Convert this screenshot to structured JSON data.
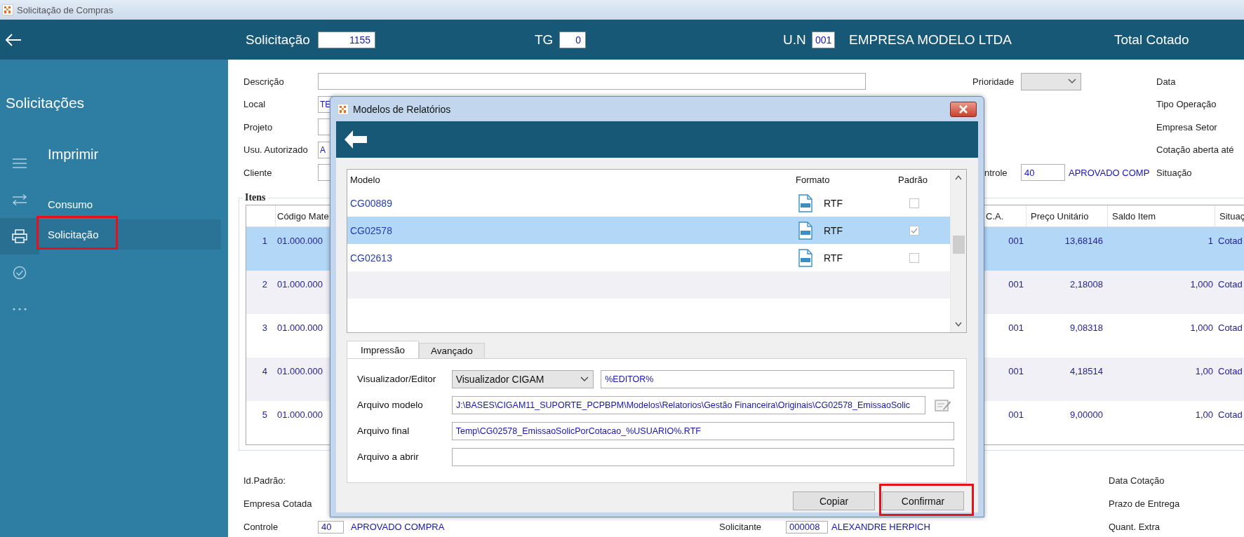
{
  "window": {
    "title": "Solicitação de Compras"
  },
  "header": {
    "fields": [
      {
        "label": "Solicitação",
        "value": "1155"
      },
      {
        "label": "TG",
        "value": "0"
      },
      {
        "label": "U.N",
        "value": "001",
        "description": "EMPRESA MODELO LTDA"
      }
    ],
    "total_label": "Total Cotado"
  },
  "sidebar": {
    "title": "Solicitações",
    "section": "Imprimir",
    "icons": [
      {
        "kind": "menu",
        "selected": false
      },
      {
        "kind": "swap",
        "selected": false
      },
      {
        "kind": "printer",
        "selected": true
      },
      {
        "kind": "check",
        "selected": false
      },
      {
        "kind": "more",
        "selected": false
      }
    ],
    "items": [
      {
        "label": "Consumo",
        "selected": false,
        "highlighted": false
      },
      {
        "label": "Solicitação",
        "selected": true,
        "highlighted": true
      }
    ]
  },
  "form": {
    "fields": [
      {
        "label": "Descrição"
      },
      {
        "label": "Local",
        "value": "TE"
      },
      {
        "label": "Projeto"
      },
      {
        "label": "Usu. Autorizado",
        "value": "A"
      },
      {
        "label": "Cliente"
      }
    ],
    "priority": {
      "label": "Prioridade"
    },
    "control": {
      "label": "ntrole",
      "value": "40",
      "description": "APROVADO COMP"
    },
    "right_labels": [
      "Data",
      "Tipo Operação",
      "Empresa Setor",
      "Cotação aberta até",
      "Situação"
    ]
  },
  "items": {
    "title": "Itens",
    "columns": [
      "Código Mate",
      "C.A.",
      "Preço Unitário",
      "Saldo Item",
      "Situaç"
    ],
    "rows": [
      {
        "number": "1",
        "code": "01.000.000",
        "ca": "001",
        "price": "13,68146",
        "balance": "1",
        "status": "Cotad",
        "selected": true
      },
      {
        "number": "2",
        "code": "01.000.000",
        "ca": "001",
        "price": "2,18008",
        "balance": "1,000",
        "status": "Cotad",
        "selected": false
      },
      {
        "number": "3",
        "code": "01.000.000",
        "ca": "001",
        "price": "9,08318",
        "balance": "1,000",
        "status": "Cotad",
        "selected": false
      },
      {
        "number": "4",
        "code": "01.000.000",
        "ca": "001",
        "price": "4,18514",
        "balance": "1,00",
        "status": "Cotad",
        "selected": false
      },
      {
        "number": "5",
        "code": "01.000.000",
        "ca": "001",
        "price": "9,00000",
        "balance": "1,00",
        "status": "Cotad",
        "selected": false
      }
    ]
  },
  "footer": {
    "left_labels": [
      "Id.Padrão:",
      "Empresa Cotada"
    ],
    "right_labels": [
      "Data Cotação",
      "Prazo de Entrega",
      "Quant. Extra"
    ],
    "control": {
      "label": "Controle",
      "value": "40",
      "description": "APROVADO COMPRA"
    },
    "requester": {
      "label": "Solicitante",
      "value": "000008",
      "description": "ALEXANDRE HERPICH"
    }
  },
  "dialog": {
    "title": "Modelos de Relatórios",
    "columns": [
      "Modelo",
      "Formato",
      "Padrão"
    ],
    "rows": [
      {
        "model": "CG00889",
        "format": "RTF",
        "checked": false,
        "selected": false
      },
      {
        "model": "CG02578",
        "format": "RTF",
        "checked": true,
        "selected": true
      },
      {
        "model": "CG02613",
        "format": "RTF",
        "checked": false,
        "selected": false
      }
    ],
    "tabs": [
      {
        "label": "Impressão",
        "selected": true
      },
      {
        "label": "Avançado",
        "selected": false
      }
    ],
    "fields": [
      {
        "kind": "select",
        "label": "Visualizador/Editor",
        "value": "Visualizador CIGAM",
        "extra": "%EDITOR%"
      },
      {
        "kind": "browse",
        "label": "Arquivo modelo",
        "value": "J:\\BASES\\CIGAM11_SUPORTE_PCPBPM\\Modelos\\Relatorios\\Gestão Financeira\\Originais\\CG02578_EmissaoSolic"
      },
      {
        "kind": "text",
        "label": "Arquivo final",
        "value": "Temp\\CG02578_EmissaoSolicPorCotacao_%USUARIO%.RTF"
      },
      {
        "kind": "text",
        "label": "Arquivo a abrir"
      }
    ],
    "buttons": [
      {
        "label": "Copiar",
        "highlighted": false
      },
      {
        "label": "Confirmar",
        "highlighted": true
      }
    ]
  }
}
